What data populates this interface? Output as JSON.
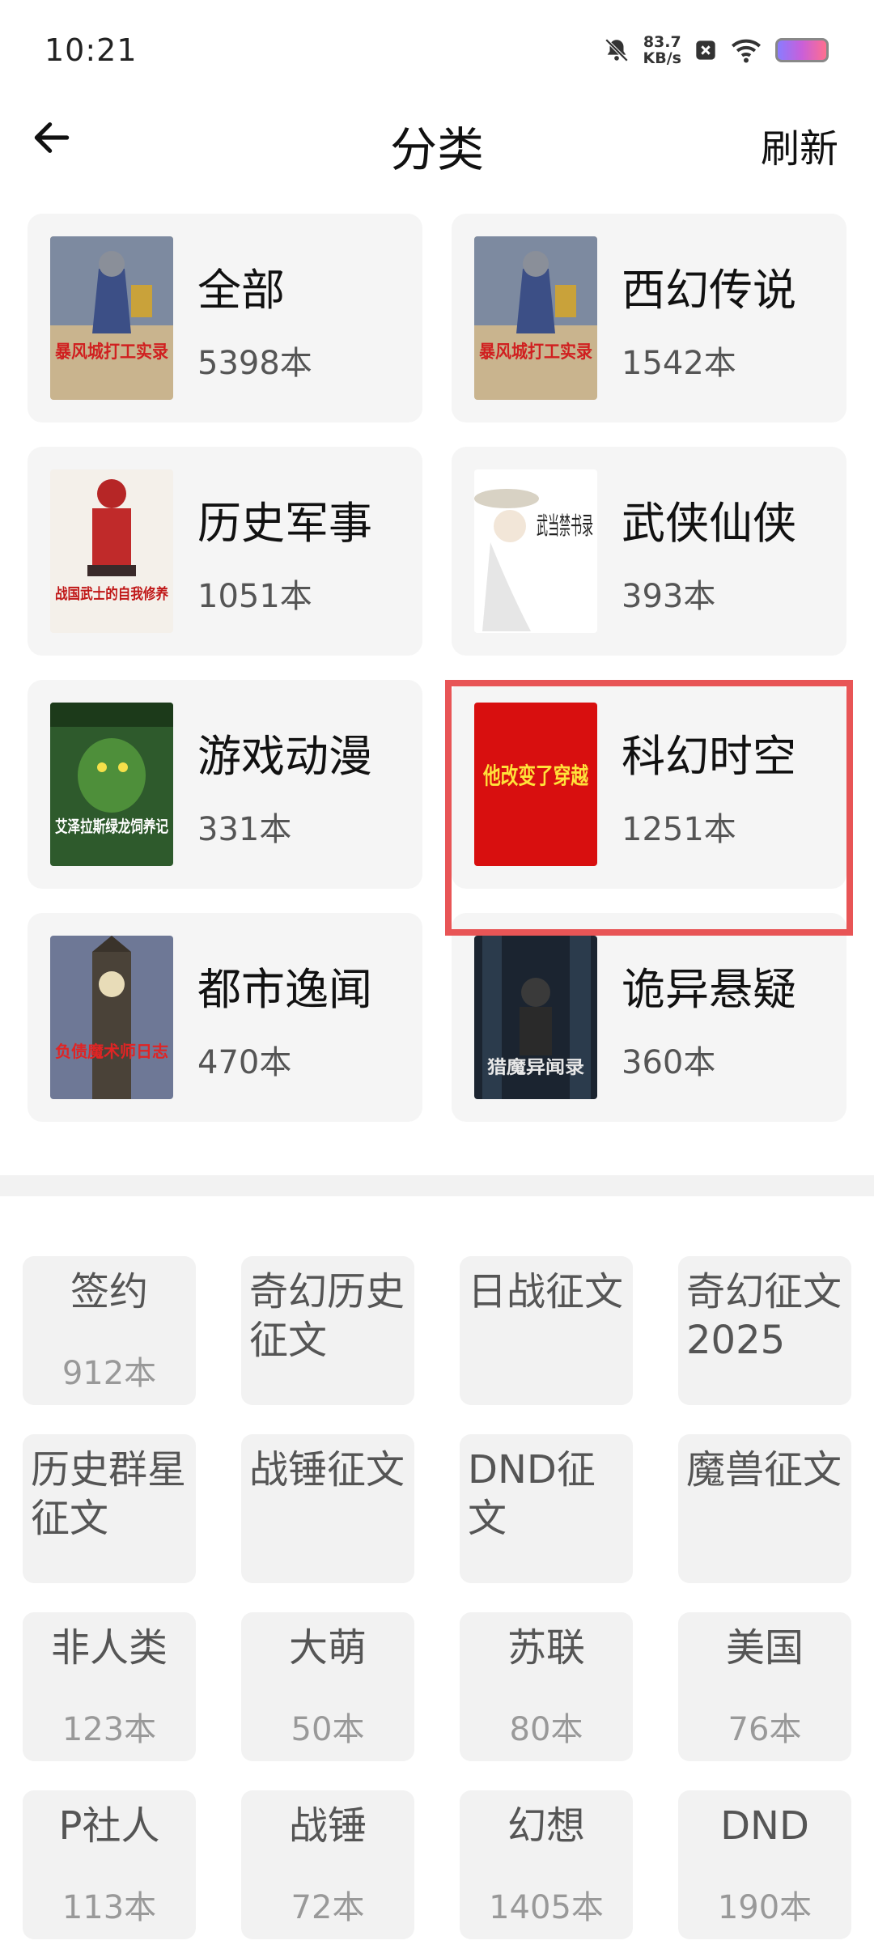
{
  "status_bar": {
    "time": "10:21",
    "speed_value": "83.7",
    "speed_unit": "KB/s"
  },
  "header": {
    "title": "分类",
    "refresh_label": "刷新"
  },
  "categories": [
    {
      "name": "全部",
      "count": "5398本",
      "cover_text": "暴风城打工实录"
    },
    {
      "name": "西幻传说",
      "count": "1542本",
      "cover_text": "暴风城打工实录"
    },
    {
      "name": "历史军事",
      "count": "1051本",
      "cover_text": "战国武士的自我修养"
    },
    {
      "name": "武侠仙侠",
      "count": "393本",
      "cover_text": "武当禁书录"
    },
    {
      "name": "游戏动漫",
      "count": "331本",
      "cover_text": "艾泽拉斯绿龙饲养记"
    },
    {
      "name": "科幻时空",
      "count": "1251本",
      "cover_text": "他改变了穿越"
    },
    {
      "name": "都市逸闻",
      "count": "470本",
      "cover_text": "负债魔术师日志"
    },
    {
      "name": "诡异悬疑",
      "count": "360本",
      "cover_text": "猎魔异闻录"
    }
  ],
  "tags": [
    {
      "name": "签约",
      "count": "912本"
    },
    {
      "name": "奇幻历史征文",
      "count": ""
    },
    {
      "name": "日战征文",
      "count": ""
    },
    {
      "name": "奇幻征文2025",
      "count": ""
    },
    {
      "name": "历史群星征文",
      "count": ""
    },
    {
      "name": "战锤征文",
      "count": ""
    },
    {
      "name": "DND征文",
      "count": ""
    },
    {
      "name": "魔兽征文",
      "count": ""
    },
    {
      "name": "非人类",
      "count": "123本"
    },
    {
      "name": "大萌",
      "count": "50本"
    },
    {
      "name": "苏联",
      "count": "80本"
    },
    {
      "name": "美国",
      "count": "76本"
    },
    {
      "name": "P社人",
      "count": "113本"
    },
    {
      "name": "战锤",
      "count": "72本"
    },
    {
      "name": "幻想",
      "count": "1405本"
    },
    {
      "name": "DND",
      "count": "190本"
    }
  ],
  "colors": {
    "highlight": "#e85556",
    "card_bg": "#f5f5f5",
    "tag_bg": "#f2f2f2"
  }
}
